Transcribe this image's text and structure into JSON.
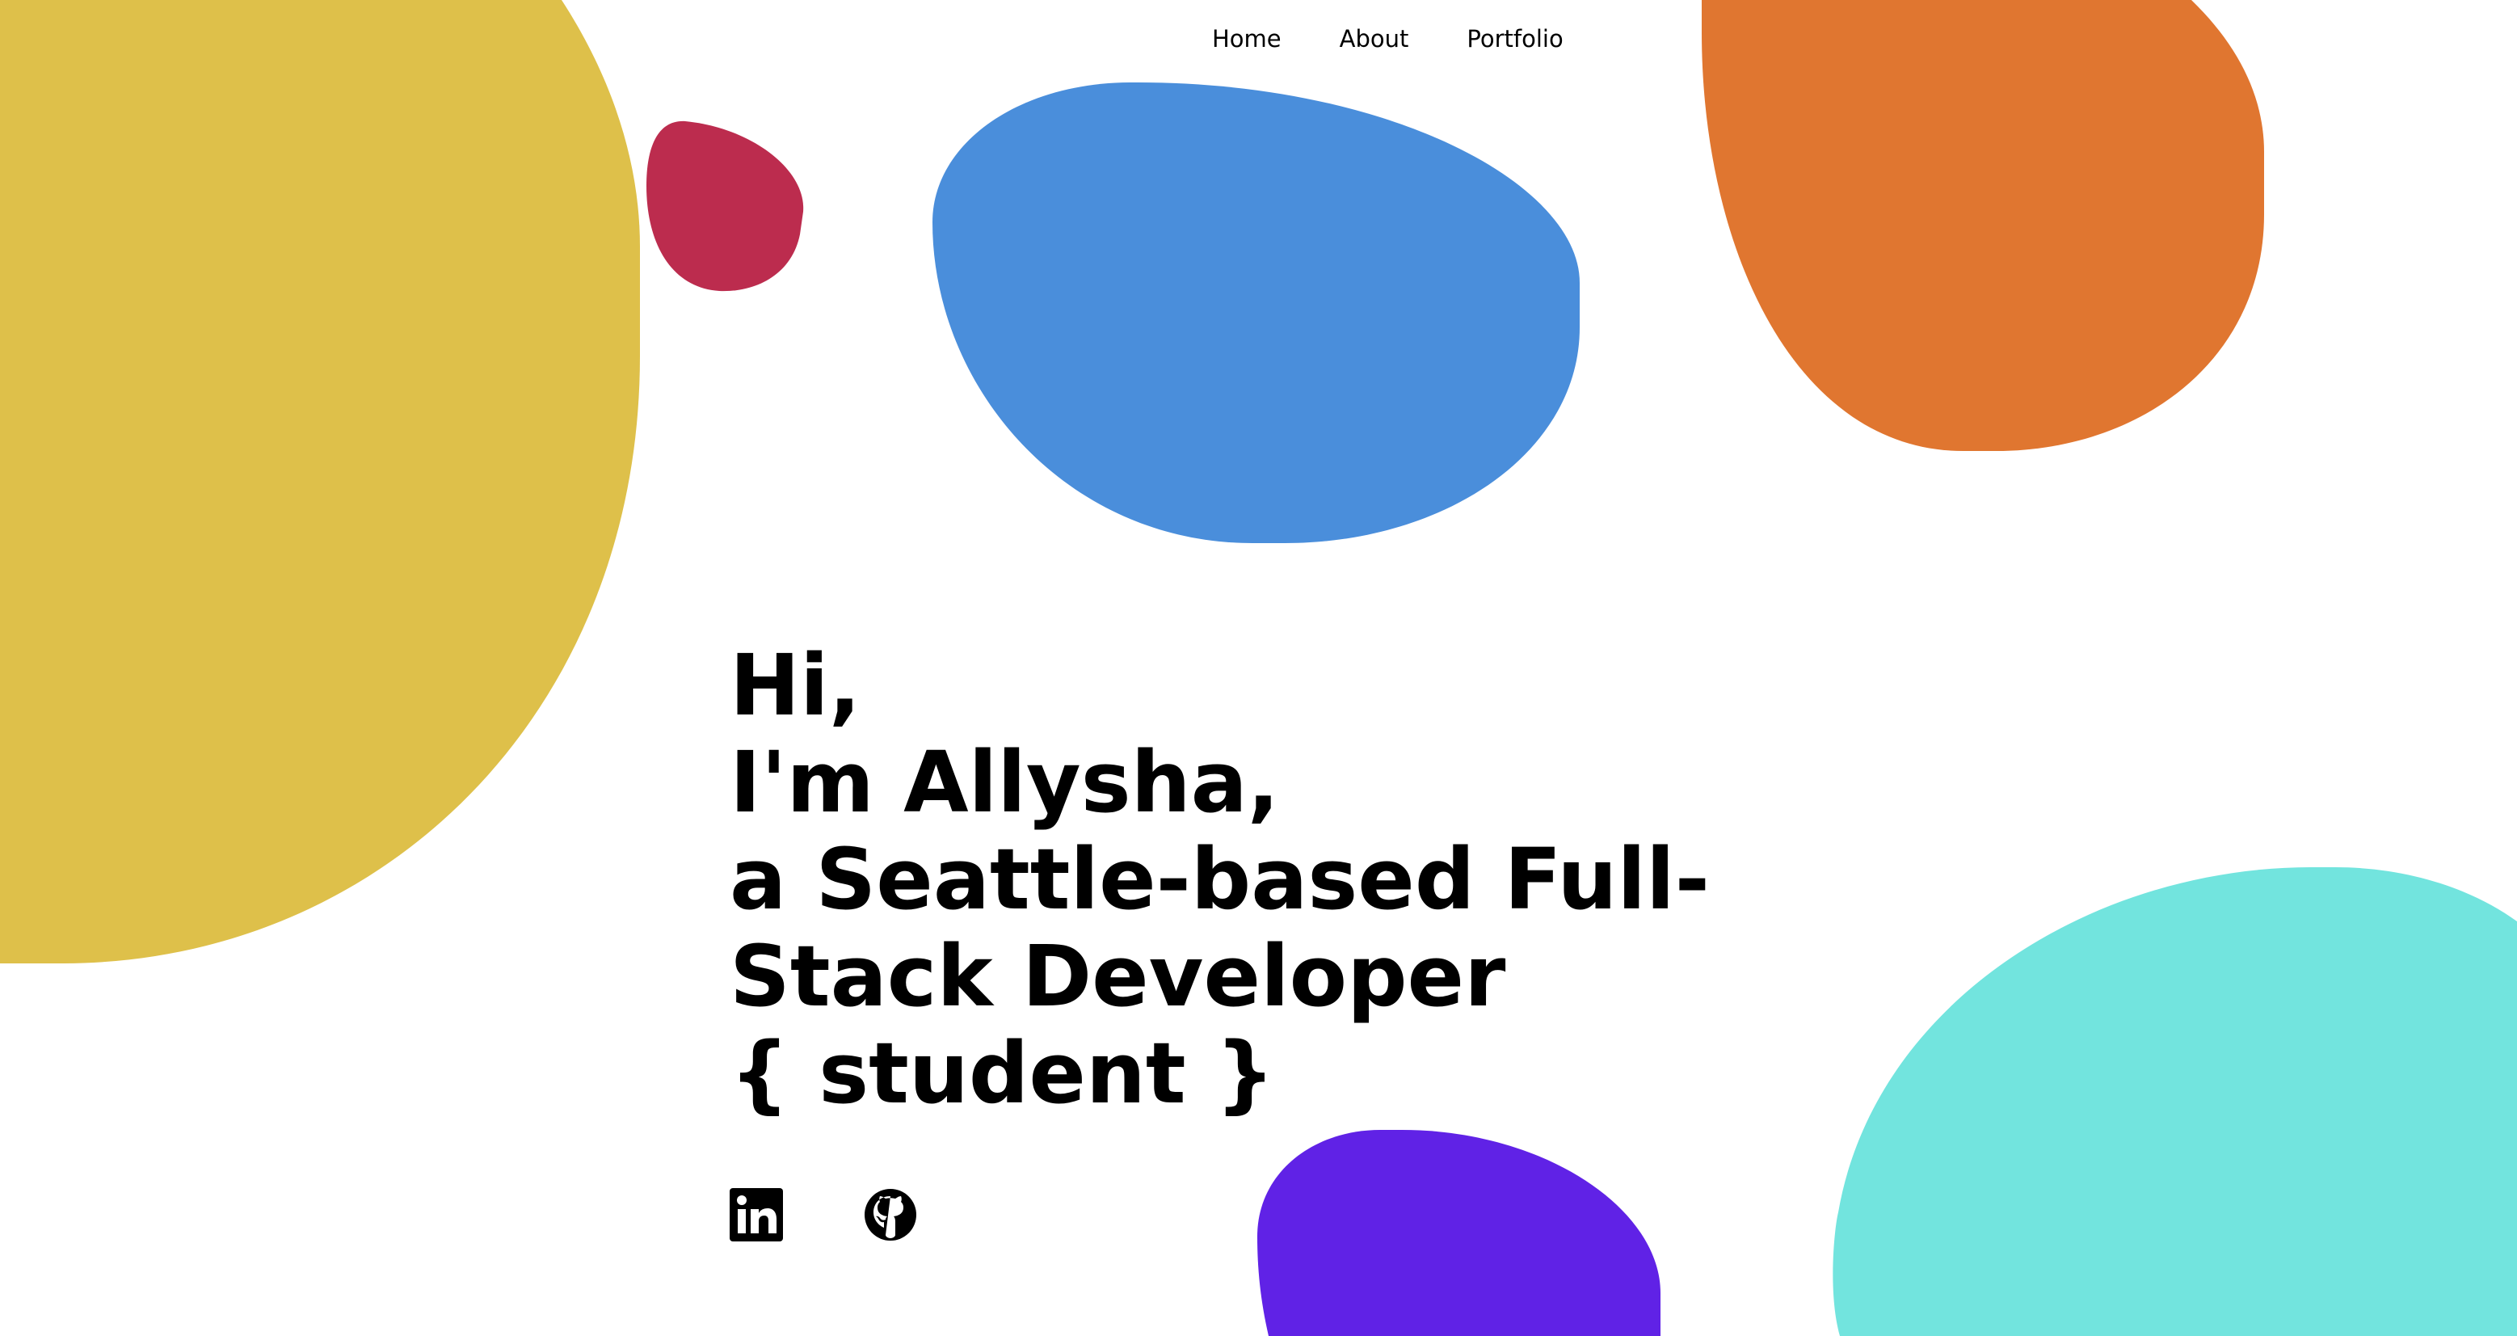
{
  "nav": {
    "items": [
      {
        "label": "Home"
      },
      {
        "label": "About"
      },
      {
        "label": "Portfolio"
      }
    ]
  },
  "hero": {
    "lines": [
      "Hi,",
      "I'm Allysha,",
      "a Seattle-based Full-",
      "Stack Developer",
      "{ student }"
    ]
  },
  "social": {
    "icons": [
      "linkedin-icon",
      "github-icon"
    ]
  },
  "colors": {
    "yellow": "#DEC04A",
    "red": "#BC2C4E",
    "blue": "#4A8EDB",
    "orange": "#E07630",
    "purple": "#6022E6",
    "cyan": "#72E4DE",
    "text": "#000000",
    "background": "#FFFFFF"
  }
}
